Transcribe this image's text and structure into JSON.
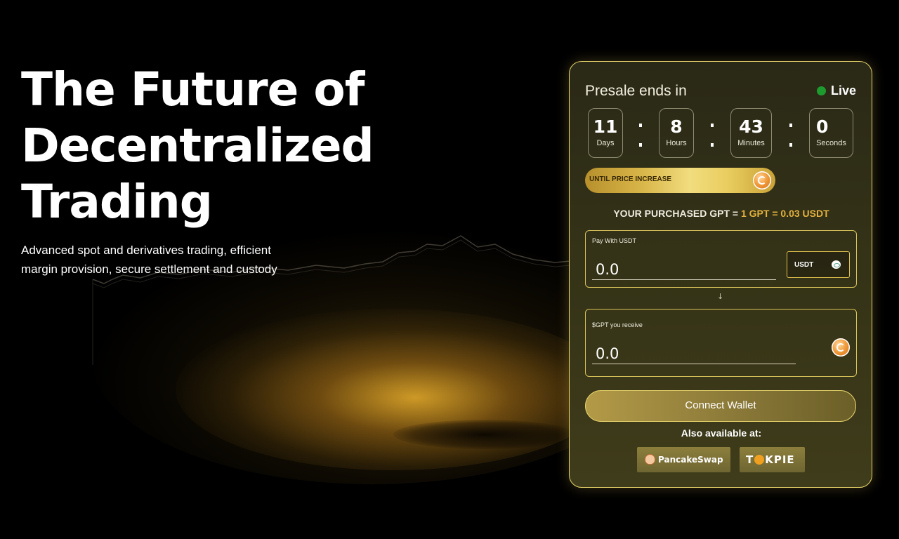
{
  "hero": {
    "title_line1": "The Future of",
    "title_line2": "Decentralized",
    "title_line3": "Trading",
    "subtitle_line1": "Advanced spot and derivatives trading, efficient",
    "subtitle_line2": "margin provision, secure settlement and custody"
  },
  "presale": {
    "heading": "Presale ends in",
    "status": "Live",
    "countdown": [
      {
        "value": "11",
        "label": "Days"
      },
      {
        "value": "8",
        "label": "Hours"
      },
      {
        "value": "43",
        "label": "Minutes"
      },
      {
        "value": "0",
        "label": "Seconds"
      }
    ],
    "price_bar_label": "UNTIL PRICE INCREASE",
    "purchased_prefix": "YOUR PURCHASED GPT = ",
    "purchased_rate": "1 GPT = 0.03 USDT",
    "pay_label": "Pay With USDT",
    "pay_value": "0.0",
    "currency_button": "USDT",
    "arrow": "↓",
    "receive_label": "$GPT you receive",
    "receive_value": "0.0",
    "connect_button": "Connect Wallet",
    "available_label": "Also available at:",
    "exchanges": [
      "PancakeSwap",
      "T",
      "KPIE"
    ]
  },
  "colors": {
    "accent_gold": "#e3b13e",
    "border_gold": "#e6d46a",
    "live_green": "#1e9b2f"
  }
}
